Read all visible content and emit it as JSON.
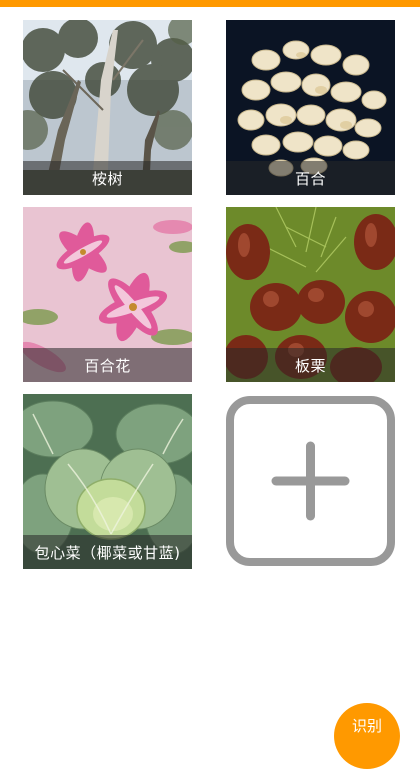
{
  "accent_color": "#ff9900",
  "gallery": {
    "items": [
      {
        "label": "桉树",
        "image": "eucalyptus-trees-photo"
      },
      {
        "label": "百合",
        "image": "lily-bulb-scales-photo"
      },
      {
        "label": "百合花",
        "image": "pink-lily-flowers-photo"
      },
      {
        "label": "板栗",
        "image": "chestnuts-photo"
      },
      {
        "label": "包心菜（椰菜或甘蓝)",
        "image": "cabbage-photo"
      }
    ],
    "add_icon": "plus-icon"
  },
  "fab": {
    "label": "识别"
  }
}
